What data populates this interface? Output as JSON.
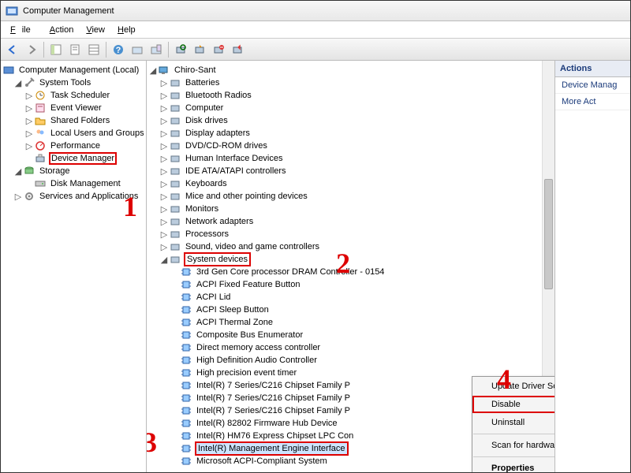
{
  "title": "Computer Management",
  "menu": {
    "file": "File",
    "action": "Action",
    "view": "View",
    "help": "Help"
  },
  "left_tree": {
    "root": "Computer Management (Local)",
    "system_tools": "System Tools",
    "task_scheduler": "Task Scheduler",
    "event_viewer": "Event Viewer",
    "shared_folders": "Shared Folders",
    "local_users": "Local Users and Groups",
    "performance": "Performance",
    "device_manager": "Device Manager",
    "storage": "Storage",
    "disk_management": "Disk Management",
    "services_apps": "Services and Applications"
  },
  "mid_root": "Chiro-Sant",
  "categories": [
    "Batteries",
    "Bluetooth Radios",
    "Computer",
    "Disk drives",
    "Display adapters",
    "DVD/CD-ROM drives",
    "Human Interface Devices",
    "IDE ATA/ATAPI controllers",
    "Keyboards",
    "Mice and other pointing devices",
    "Monitors",
    "Network adapters",
    "Processors",
    "Sound, video and game controllers",
    "System devices"
  ],
  "system_devices": [
    "3rd Gen Core processor DRAM Controller - 0154",
    "ACPI Fixed Feature Button",
    "ACPI Lid",
    "ACPI Sleep Button",
    "ACPI Thermal Zone",
    "Composite Bus Enumerator",
    "Direct memory access controller",
    "High Definition Audio Controller",
    "High precision event timer",
    "Intel(R) 7 Series/C216 Chipset Family P",
    "Intel(R) 7 Series/C216 Chipset Family P",
    "Intel(R) 7 Series/C216 Chipset Family P",
    "Intel(R) 82802 Firmware Hub Device",
    "Intel(R) HM76 Express Chipset LPC Con",
    "Intel(R) Management Engine Interface",
    "Microsoft ACPI-Compliant System"
  ],
  "context_menu": {
    "update": "Update Driver Software...",
    "disable": "Disable",
    "uninstall": "Uninstall",
    "scan": "Scan for hardware changes",
    "properties": "Properties"
  },
  "actions": {
    "header": "Actions",
    "dm": "Device Manag",
    "more": "More Act"
  },
  "annotations": {
    "a1": "1",
    "a2": "2",
    "a3": "3",
    "a4": "4"
  }
}
